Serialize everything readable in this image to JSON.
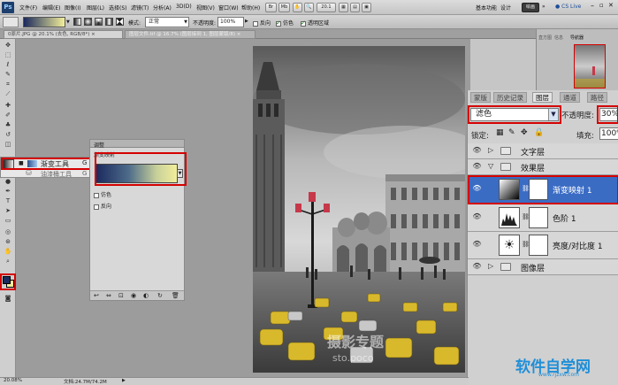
{
  "menubar": {
    "items": [
      "文件(F)",
      "编辑(E)",
      "图像(I)",
      "图层(L)",
      "选择(S)",
      "滤镜(T)",
      "分析(A)",
      "3D(D)",
      "视图(V)",
      "窗口(W)",
      "帮助(H)"
    ],
    "zoom_value": "20.1",
    "workspace": "基本功能",
    "design_tab": "设计",
    "painting_tab": "绘画",
    "more": "»",
    "cslive": "CS Live"
  },
  "options": {
    "mode_label": "模式:",
    "mode_value": "正常",
    "opacity_label": "不透明度:",
    "opacity_value": "100%",
    "reverse_label": "反向",
    "dither_label": "仿色",
    "transparency_label": "透明区域"
  },
  "tabs": [
    {
      "label": "0原片.JPG @ 20.1% (去色, RGB/8*) ×"
    },
    {
      "label": "图层文件.tif @ 16.7% (图层接到 1, 图层蒙版/8) ×"
    }
  ],
  "flyout": {
    "item1": "渐变工具",
    "item1_key": "G",
    "item2": "油漆桶工具",
    "item2_key": "G"
  },
  "adjust": {
    "title": "调整",
    "subtitle": "渐变映射",
    "dither": "仿色",
    "reverse": "反向"
  },
  "navigator": {
    "tab1": "导航器",
    "tab2": "直方图",
    "tab3": "信息"
  },
  "layers": {
    "tabs": [
      "蒙版",
      "历史记录",
      "图层",
      "通道",
      "路径"
    ],
    "blend_mode": "滤色",
    "opacity_label": "不透明度:",
    "opacity_value": "30%",
    "lock_label": "锁定:",
    "fill_label": "填充:",
    "fill_value": "100%",
    "rows": [
      {
        "name": "文字层",
        "kind": "group"
      },
      {
        "name": "效果层",
        "kind": "group-open"
      },
      {
        "name": "渐变映射 1",
        "kind": "adjust-selected"
      },
      {
        "name": "色阶 1",
        "kind": "adjust"
      },
      {
        "name": "亮度/对比度 1",
        "kind": "adjust"
      },
      {
        "name": "图像层",
        "kind": "group"
      }
    ]
  },
  "status": {
    "zoom": "20.08%",
    "doc": "文档:24.7M/74.2M"
  },
  "watermark": {
    "text1": "摄影专题",
    "text2": "sto.poco",
    "logo": "软件自学网",
    "url": "www.rjzxw.com"
  },
  "colors": {
    "accent_red": "#d40000",
    "selected_blue": "#3b6cc4",
    "gradient_start": "#1b2a5e",
    "gradient_end": "#f2ee9a"
  }
}
